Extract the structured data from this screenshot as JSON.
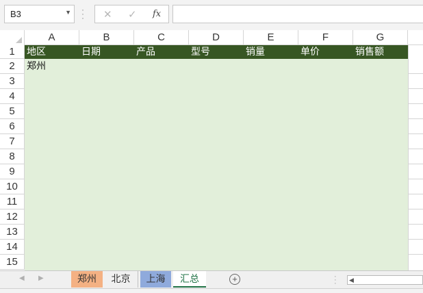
{
  "formula_bar": {
    "name_box": "B3",
    "cancel_glyph": "✕",
    "enter_glyph": "✓",
    "fx_label": "fx",
    "formula_value": ""
  },
  "columns": [
    "A",
    "B",
    "C",
    "D",
    "E",
    "F",
    "G"
  ],
  "rows": [
    "1",
    "2",
    "3",
    "4",
    "5",
    "6",
    "7",
    "8",
    "9",
    "10",
    "11",
    "12",
    "13",
    "14",
    "15"
  ],
  "header_row": [
    "地区",
    "日期",
    "产品",
    "型号",
    "销量",
    "单价",
    "销售额"
  ],
  "cell_a2": "郑州",
  "colors": {
    "header_fill": "#375623",
    "data_fill": "#e2efda",
    "tab_zhengzhou": "#f4b183",
    "tab_shanghai": "#8faadc",
    "active_tab_text": "#217346"
  },
  "sheet_tabs": [
    {
      "label": "郑州"
    },
    {
      "label": "北京"
    },
    {
      "label": "上海"
    },
    {
      "label": "汇总"
    }
  ],
  "add_sheet_glyph": "+",
  "nav_prev": "◀",
  "nav_next": "▶"
}
